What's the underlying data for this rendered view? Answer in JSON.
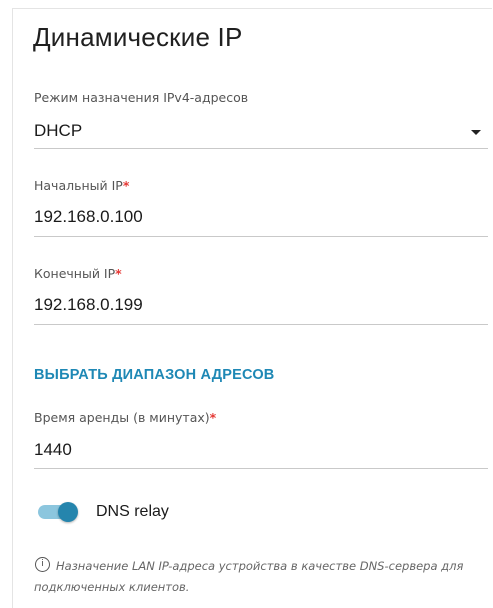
{
  "section": {
    "title": "Динамические IP"
  },
  "mode": {
    "label": "Режим назначения IPv4-адресов",
    "value": "DHCP"
  },
  "start_ip": {
    "label": "Начальный IP",
    "required_mark": "*",
    "value": "192.168.0.100"
  },
  "end_ip": {
    "label": "Конечный IP",
    "required_mark": "*",
    "value": "192.168.0.199"
  },
  "range_link": {
    "label": "ВЫБРАТЬ ДИАПАЗОН АДРЕСОВ"
  },
  "lease": {
    "label": "Время аренды (в минутах)",
    "required_mark": "*",
    "value": "1440"
  },
  "dns_relay": {
    "label": "DNS relay",
    "enabled": true
  },
  "info": {
    "icon_glyph": "i",
    "text": "Назначение LAN IP-адреса устройства в качестве DNS-сервера для подключенных клиентов."
  },
  "colors": {
    "accent": "#1e88b5",
    "required": "#e53935",
    "toggle_knob": "#2585ad",
    "toggle_track": "#8cc6de"
  },
  "icons": {
    "dropdown": "chevron-down-icon",
    "info": "info-icon"
  }
}
